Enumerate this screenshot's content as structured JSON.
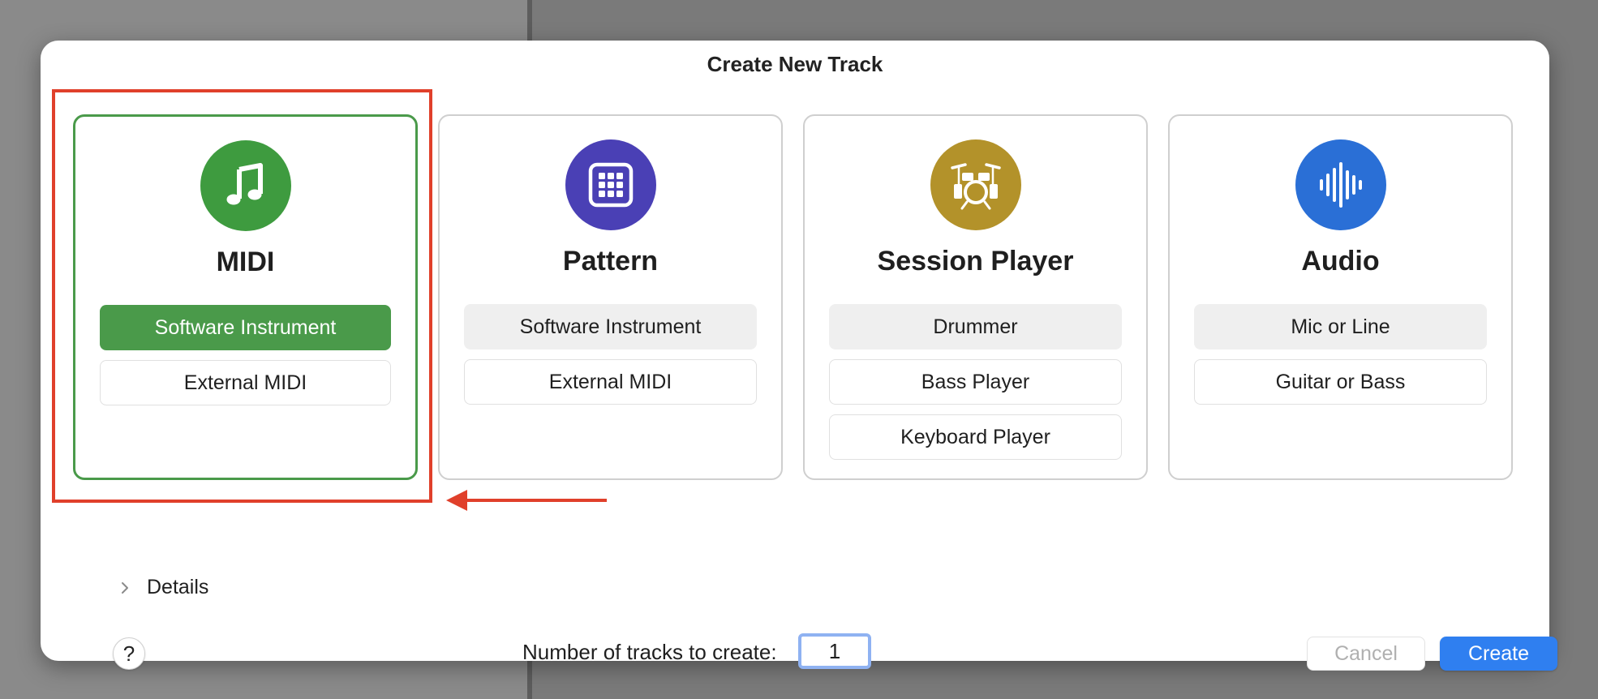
{
  "dialog": {
    "title": "Create New Track"
  },
  "cards": [
    {
      "title": "MIDI",
      "icon": "music-note-icon",
      "color": "#3e9b3f",
      "options": [
        "Software Instrument",
        "External MIDI"
      ]
    },
    {
      "title": "Pattern",
      "icon": "grid-pads-icon",
      "color": "#4a40b5",
      "options": [
        "Software Instrument",
        "External MIDI"
      ]
    },
    {
      "title": "Session Player",
      "icon": "drum-kit-icon",
      "color": "#b3922a",
      "options": [
        "Drummer",
        "Bass Player",
        "Keyboard Player"
      ]
    },
    {
      "title": "Audio",
      "icon": "waveform-icon",
      "color": "#2a6fd6",
      "options": [
        "Mic or Line",
        "Guitar or Bass"
      ]
    }
  ],
  "selection": {
    "selected_card": "MIDI",
    "selected_option": "Software Instrument"
  },
  "details": {
    "label": "Details"
  },
  "footer": {
    "help_label": "?",
    "tracks_label": "Number of tracks to create:",
    "tracks_value": "1",
    "cancel_label": "Cancel",
    "create_label": "Create"
  },
  "colors": {
    "accent_green": "#4a9a4a",
    "annotation_red": "#e0402b",
    "primary_blue": "#2f7ff0"
  }
}
